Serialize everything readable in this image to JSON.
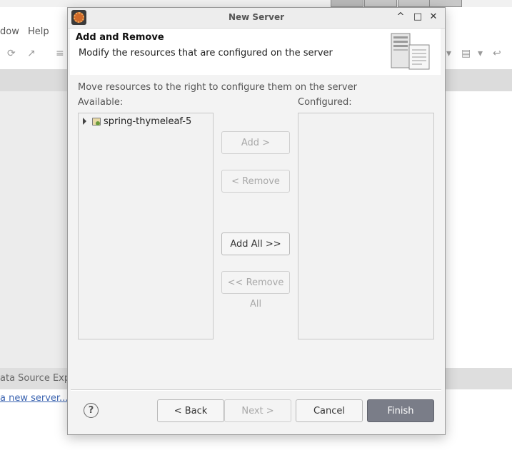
{
  "background": {
    "menu": [
      "dow",
      "Help"
    ],
    "bottom_tab": "ata Source Explo",
    "link": "a new server..."
  },
  "dialog": {
    "title": "New Server",
    "header": {
      "title": "Add and Remove",
      "description": "Modify the resources that are configured on the server"
    },
    "content": {
      "description": "Move resources to the right to configure them on the server",
      "available_label": "Available:",
      "configured_label": "Configured:",
      "available_items": [
        {
          "label": "spring-thymeleaf-5",
          "icon": "project-icon",
          "expanded": false
        }
      ],
      "configured_items": []
    },
    "buttons": {
      "add": "Add >",
      "remove": "< Remove",
      "add_all": "Add All >>",
      "remove_all": "<< Remove All"
    },
    "footer": {
      "help_glyph": "?",
      "back": "< Back",
      "next": "Next >",
      "cancel": "Cancel",
      "finish": "Finish"
    },
    "window_controls": {
      "minimize": "^",
      "maximize": "□",
      "close": "✕"
    }
  },
  "colors": {
    "finish_button": "#7a7d88",
    "dialog_bg": "#f3f3f3",
    "header_bg": "#ffffff",
    "link": "#3a63b0"
  }
}
